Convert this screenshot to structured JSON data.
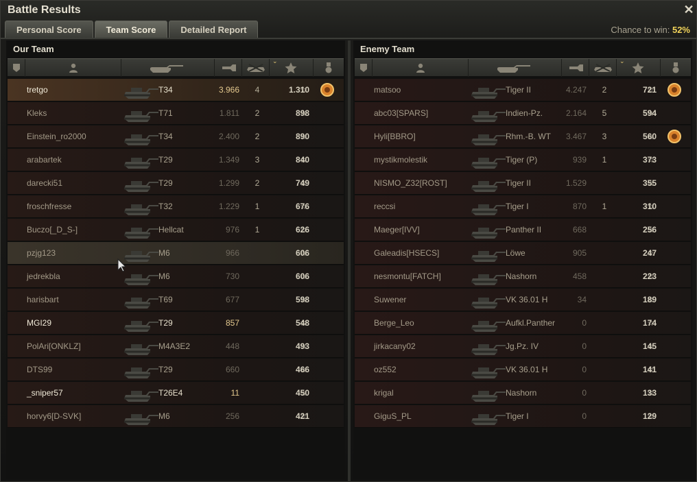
{
  "window": {
    "title": "Battle Results",
    "close_icon": "close-icon"
  },
  "tabs": [
    {
      "label": "Personal Score",
      "active": false
    },
    {
      "label": "Team Score",
      "active": true
    },
    {
      "label": "Detailed Report",
      "active": false
    }
  ],
  "chance": {
    "label": "Chance to win:",
    "value": "52%"
  },
  "our_team": {
    "title": "Our Team",
    "rows": [
      {
        "name": "tretgo",
        "tank": "T34",
        "xp": "3.966",
        "kills": "4",
        "score": "1.310",
        "medal": true,
        "style": "player"
      },
      {
        "name": "Kleks",
        "tank": "T71",
        "xp": "1.811",
        "kills": "2",
        "score": "898",
        "medal": false,
        "style": ""
      },
      {
        "name": "Einstein_ro2000",
        "tank": "T34",
        "xp": "2.400",
        "kills": "2",
        "score": "890",
        "medal": false,
        "style": ""
      },
      {
        "name": "arabartek",
        "tank": "T29",
        "xp": "1.349",
        "kills": "3",
        "score": "840",
        "medal": false,
        "style": ""
      },
      {
        "name": "darecki51",
        "tank": "T29",
        "xp": "1.299",
        "kills": "2",
        "score": "749",
        "medal": false,
        "style": ""
      },
      {
        "name": "froschfresse",
        "tank": "T32",
        "xp": "1.229",
        "kills": "1",
        "score": "676",
        "medal": false,
        "style": ""
      },
      {
        "name": "Buczo[_D_S-]",
        "tank": "Hellcat",
        "xp": "976",
        "kills": "1",
        "score": "626",
        "medal": false,
        "style": ""
      },
      {
        "name": "pzjg123",
        "tank": "M6",
        "xp": "966",
        "kills": "",
        "score": "606",
        "medal": false,
        "style": "hover"
      },
      {
        "name": "jedrekbla",
        "tank": "M6",
        "xp": "730",
        "kills": "",
        "score": "606",
        "medal": false,
        "style": ""
      },
      {
        "name": "harisbart",
        "tank": "T69",
        "xp": "677",
        "kills": "",
        "score": "598",
        "medal": false,
        "style": ""
      },
      {
        "name": "MGI29",
        "tank": "T29",
        "xp": "857",
        "kills": "",
        "score": "548",
        "medal": false,
        "style": "bold"
      },
      {
        "name": "PolAri[ONKLZ]",
        "tank": "M4A3E2",
        "xp": "448",
        "kills": "",
        "score": "493",
        "medal": false,
        "style": ""
      },
      {
        "name": "DTS99",
        "tank": "T29",
        "xp": "660",
        "kills": "",
        "score": "466",
        "medal": false,
        "style": ""
      },
      {
        "name": "_sniper57",
        "tank": "T26E4",
        "xp": "11",
        "kills": "",
        "score": "450",
        "medal": false,
        "style": "bold"
      },
      {
        "name": "horvy6[D-SVK]",
        "tank": "M6",
        "xp": "256",
        "kills": "",
        "score": "421",
        "medal": false,
        "style": ""
      }
    ]
  },
  "enemy_team": {
    "title": "Enemy Team",
    "rows": [
      {
        "name": "matsoo",
        "tank": "Tiger II",
        "xp": "4.247",
        "kills": "2",
        "score": "721",
        "medal": true
      },
      {
        "name": "abc03[SPARS]",
        "tank": "Indien-Pz.",
        "xp": "2.164",
        "kills": "5",
        "score": "594",
        "medal": false
      },
      {
        "name": "Hyli[BBRO]",
        "tank": "Rhm.-B. WT",
        "xp": "3.467",
        "kills": "3",
        "score": "560",
        "medal": true
      },
      {
        "name": "mystikmolestik",
        "tank": "Tiger (P)",
        "xp": "939",
        "kills": "1",
        "score": "373",
        "medal": false
      },
      {
        "name": "NISMO_Z32[ROST]",
        "tank": "Tiger II",
        "xp": "1.529",
        "kills": "",
        "score": "355",
        "medal": false
      },
      {
        "name": "reccsi",
        "tank": "Tiger I",
        "xp": "870",
        "kills": "1",
        "score": "310",
        "medal": false
      },
      {
        "name": "Maeger[IVV]",
        "tank": "Panther II",
        "xp": "668",
        "kills": "",
        "score": "256",
        "medal": false
      },
      {
        "name": "Galeadis[HSECS]",
        "tank": "Löwe",
        "xp": "905",
        "kills": "",
        "score": "247",
        "medal": false
      },
      {
        "name": "nesmontu[FATCH]",
        "tank": "Nashorn",
        "xp": "458",
        "kills": "",
        "score": "223",
        "medal": false
      },
      {
        "name": "Suwener",
        "tank": "VK 36.01 H",
        "xp": "34",
        "kills": "",
        "score": "189",
        "medal": false
      },
      {
        "name": "Berge_Leo",
        "tank": "Aufkl.Panther",
        "xp": "0",
        "kills": "",
        "score": "174",
        "medal": false
      },
      {
        "name": "jirkacany02",
        "tank": "Jg.Pz. IV",
        "xp": "0",
        "kills": "",
        "score": "145",
        "medal": false
      },
      {
        "name": "oz552",
        "tank": "VK 36.01 H",
        "xp": "0",
        "kills": "",
        "score": "141",
        "medal": false
      },
      {
        "name": "krigal",
        "tank": "Nashorn",
        "xp": "0",
        "kills": "",
        "score": "133",
        "medal": false
      },
      {
        "name": "GiguS_PL",
        "tank": "Tiger I",
        "xp": "0",
        "kills": "",
        "score": "129",
        "medal": false
      }
    ]
  },
  "header_icons": [
    "platoon-icon",
    "player-icon",
    "tank-icon",
    "damage-icon",
    "kills-icon",
    "score-icon",
    "medal-icon"
  ],
  "colors": {
    "accent": "#f1d35a",
    "player_row": "#4a3422",
    "medal": "#d9822b"
  }
}
